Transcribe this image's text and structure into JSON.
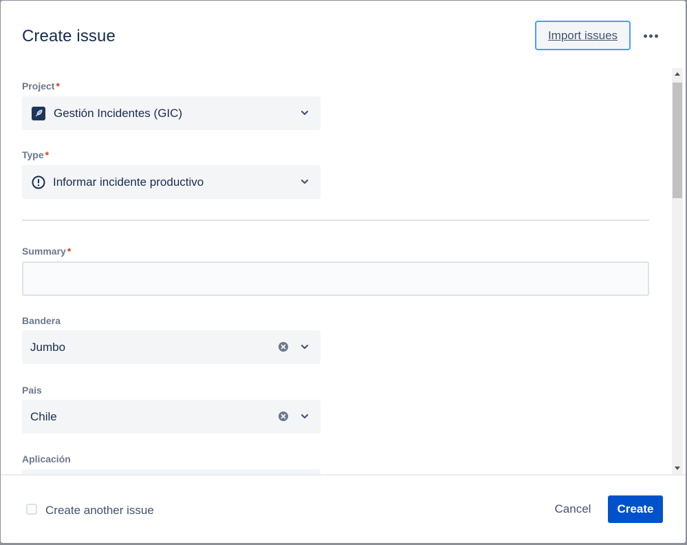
{
  "dialog": {
    "title": "Create issue",
    "import_label": "Import issues"
  },
  "fields": {
    "project": {
      "label": "Project",
      "required": "*",
      "value": "Gestión Incidentes (GIC)"
    },
    "type": {
      "label": "Type",
      "required": "*",
      "value": "Informar incidente productivo"
    },
    "summary": {
      "label": "Summary",
      "required": "*",
      "value": ""
    },
    "bandera": {
      "label": "Bandera",
      "value": "Jumbo"
    },
    "pais": {
      "label": "Pais",
      "value": "Chile"
    },
    "aplicacion": {
      "label": "Aplicación",
      "value": ""
    }
  },
  "footer": {
    "create_another_label": "Create another issue",
    "cancel_label": "Cancel",
    "create_label": "Create"
  },
  "colors": {
    "primary": "#0052cc",
    "focus_ring": "#4c9aff",
    "required": "#de350b",
    "field_bg": "#f4f5f7"
  },
  "icons": [
    "project-rocket-icon",
    "exclamation-circle-icon",
    "chevron-down-icon",
    "clear-icon",
    "more-icon"
  ]
}
